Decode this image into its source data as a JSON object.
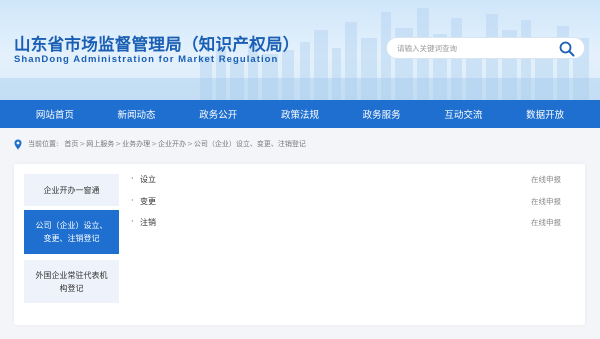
{
  "header": {
    "title": "山东省市场监督管理局（知识产权局）",
    "subtitle": "ShanDong Administration for Market Regulation",
    "search_placeholder": "请输入关键词查询",
    "search_icon": "search-icon"
  },
  "nav": {
    "items": [
      {
        "label": "网站首页"
      },
      {
        "label": "新闻动态"
      },
      {
        "label": "政务公开"
      },
      {
        "label": "政策法规"
      },
      {
        "label": "政务服务"
      },
      {
        "label": "互动交流"
      },
      {
        "label": "数据开放"
      }
    ]
  },
  "breadcrumb": {
    "icon": "location-pin-icon",
    "label": "当前位置:",
    "items": [
      "首页",
      "网上服务",
      "业务办理",
      "企业开办",
      "公司（企业）设立、变更、注销登记"
    ],
    "separator": ">"
  },
  "side_menu": {
    "items": [
      {
        "label": "企业开办一窗通",
        "active": false
      },
      {
        "label": "公司（企业）设立、变更、注销登记",
        "active": true
      },
      {
        "label": "外国企业常驻代表机构登记",
        "active": false
      }
    ]
  },
  "services": {
    "bullet": "·",
    "items": [
      {
        "name": "设立",
        "action": "在线申报"
      },
      {
        "name": "变更",
        "action": "在线申报"
      },
      {
        "name": "注销",
        "action": "在线申报"
      }
    ]
  },
  "colors": {
    "primary": "#1e6fcf",
    "title": "#1a5fb4",
    "page_bg": "#f3f5f9",
    "side_item_bg": "#eef2fa"
  }
}
